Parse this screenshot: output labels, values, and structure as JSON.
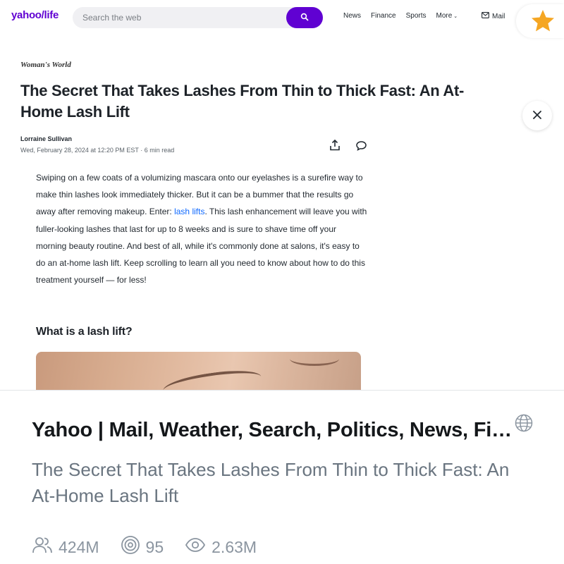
{
  "browser": {
    "brand": "yahoo/life",
    "search_placeholder": "Search the web",
    "nav": [
      "News",
      "Finance",
      "Sports",
      "More"
    ],
    "mail_label": "Mail"
  },
  "article": {
    "publication": "Woman's World",
    "headline": "The Secret That Takes Lashes From Thin to Thick Fast: An At-Home Lash Lift",
    "author": "Lorraine Sullivan",
    "meta": "Wed, February 28, 2024 at 12:20 PM EST · 6 min read",
    "body_before_link": "Swiping on a few coats of a volumizing mascara onto our eyelashes is a surefire way to make thin lashes look immediately thicker. But it can be a bummer that the results go away after removing makeup. Enter: ",
    "body_link": "lash lifts",
    "body_after_link": ". This lash enhancement will leave you with fuller-looking lashes that last for up to 8 weeks and is sure to shave time off your morning beauty routine. And best of all, while it's commonly done at salons, it's easy to do an at-home lash lift. Keep scrolling to learn all you need to know about how to do this treatment yourself — for less!",
    "subheading": "What is a lash lift?"
  },
  "card": {
    "site_title": "Yahoo | Mail, Weather, Search, Politics, News, Finance, Sports & Videos",
    "description": "The Secret That Takes Lashes From Thin to Thick Fast: An At-Home Lash Lift",
    "stats": {
      "users": "424M",
      "mentions": "95",
      "views": "2.63M"
    }
  },
  "colors": {
    "yahoo_purple": "#6001d2",
    "star": "#f5a623",
    "link_blue": "#0f69ff",
    "muted_text": "#6a7580"
  },
  "icons": [
    "search-icon",
    "chevron-down-icon",
    "mail-icon",
    "star-icon",
    "close-icon",
    "share-icon",
    "comment-icon",
    "globe-icon",
    "users-icon",
    "mentions-icon",
    "views-icon"
  ]
}
